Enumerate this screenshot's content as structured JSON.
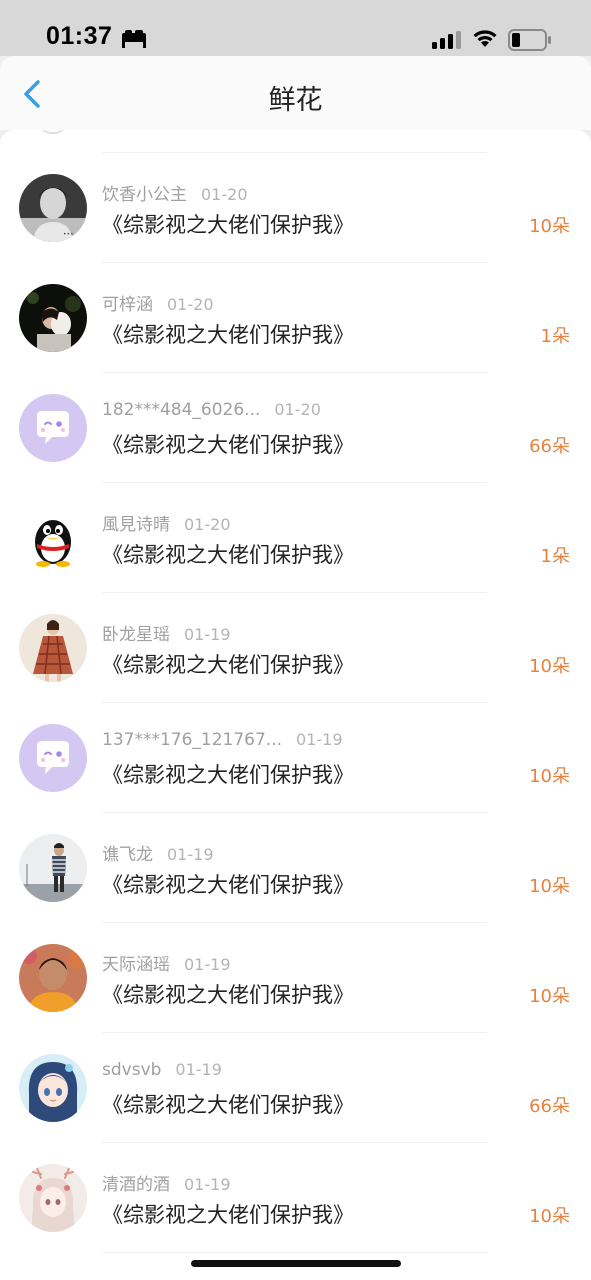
{
  "status_bar": {
    "time": "01:37",
    "icons": [
      "bed-icon",
      "cellular-signal-icon",
      "wifi-icon",
      "battery-icon"
    ]
  },
  "nav": {
    "title": "鲜花",
    "back_icon": "chevron-left-icon"
  },
  "colors": {
    "accent_back": "#3a9ee6",
    "flower_count": "#e5833e",
    "bot_avatar_bg": "#d4c7f2",
    "bot_avatar_face": "#a486e6"
  },
  "items": [
    {
      "user": "饮香小公主",
      "date": "01-20",
      "book": "《综影视之大佬们保护我》",
      "flowers": "10朵",
      "avatar": "grayscale-photo-avatar"
    },
    {
      "user": "可梓涵",
      "date": "01-20",
      "book": "《综影视之大佬们保护我》",
      "flowers": "1朵",
      "avatar": "night-couple-photo-avatar"
    },
    {
      "user": "182***484_6026...",
      "date": "01-20",
      "book": "《综影视之大佬们保护我》",
      "flowers": "66朵",
      "avatar": "chat-bubble-default-avatar"
    },
    {
      "user": "風見诗晴",
      "date": "01-20",
      "book": "《综影视之大佬们保护我》",
      "flowers": "1朵",
      "avatar": "qq-penguin-avatar"
    },
    {
      "user": "卧龙星瑶",
      "date": "01-19",
      "book": "《综影视之大佬们保护我》",
      "flowers": "10朵",
      "avatar": "plaid-dress-photo-avatar"
    },
    {
      "user": "137***176_121767...",
      "date": "01-19",
      "book": "《综影视之大佬们保护我》",
      "flowers": "10朵",
      "avatar": "chat-bubble-default-avatar"
    },
    {
      "user": "谯飞龙",
      "date": "01-19",
      "book": "《综影视之大佬们保护我》",
      "flowers": "10朵",
      "avatar": "man-standing-photo-avatar"
    },
    {
      "user": "天际涵瑶",
      "date": "01-19",
      "book": "《综影视之大佬们保护我》",
      "flowers": "10朵",
      "avatar": "woman-portrait-photo-avatar"
    },
    {
      "user": "sdvsvb",
      "date": "01-19",
      "book": "《综影视之大佬们保护我》",
      "flowers": "66朵",
      "avatar": "anime-girl-avatar"
    },
    {
      "user": "清酒的酒",
      "date": "01-19",
      "book": "《综影视之大佬们保护我》",
      "flowers": "10朵",
      "avatar": "anime-deer-girl-avatar"
    }
  ]
}
